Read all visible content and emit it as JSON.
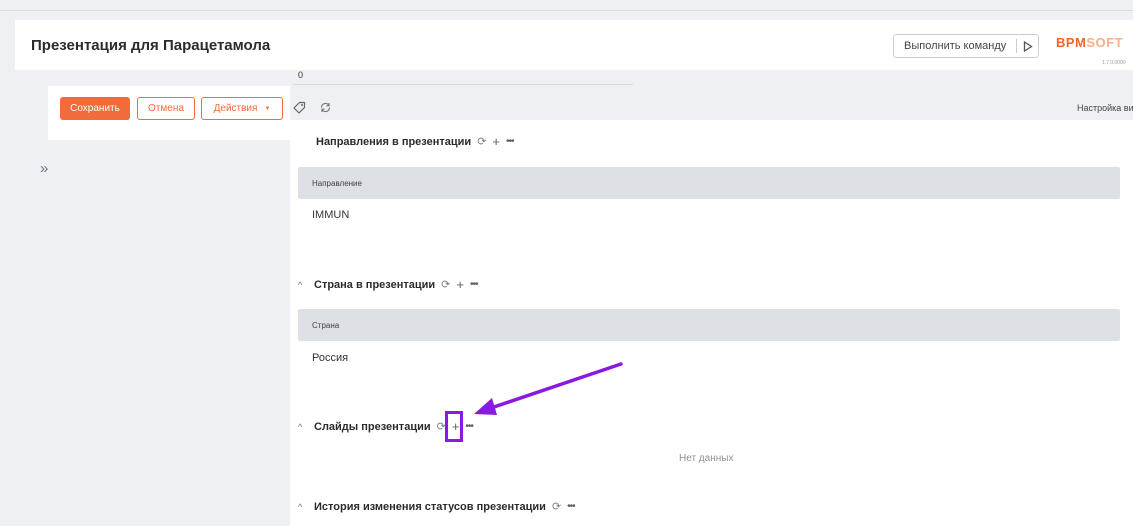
{
  "header": {
    "title": "Презентация для Парацетамола",
    "run_command_label": "Выполнить команду",
    "logo_part1": "BPM",
    "logo_part2": "SOFT",
    "version": "1.7.0.0000"
  },
  "field": {
    "value": "0"
  },
  "actions": {
    "save_label": "Сохранить",
    "cancel_label": "Отмена",
    "actions_label": "Действия",
    "view_settings_label": "Настройка вид"
  },
  "sections": {
    "directions": {
      "title": "Направления в презентации",
      "column": "Направление",
      "rows": [
        "IMMUN"
      ]
    },
    "countries": {
      "title": "Страна в презентации",
      "column": "Страна",
      "rows": [
        "Россия"
      ]
    },
    "slides": {
      "title": "Слайды презентации",
      "empty_text": "Нет данных"
    },
    "history": {
      "title": "История изменения статусов презентации"
    }
  },
  "icons": {
    "refresh": "refresh-icon",
    "add": "plus-icon",
    "more": "more-icon",
    "tag": "tag-icon",
    "chevron": "chevron-up-icon",
    "expand": "double-chevron-right-icon",
    "run": "play-icon"
  },
  "colors": {
    "accent": "#f26b3a",
    "highlight": "#8a1ae0",
    "grid_header": "#dde0e5"
  }
}
